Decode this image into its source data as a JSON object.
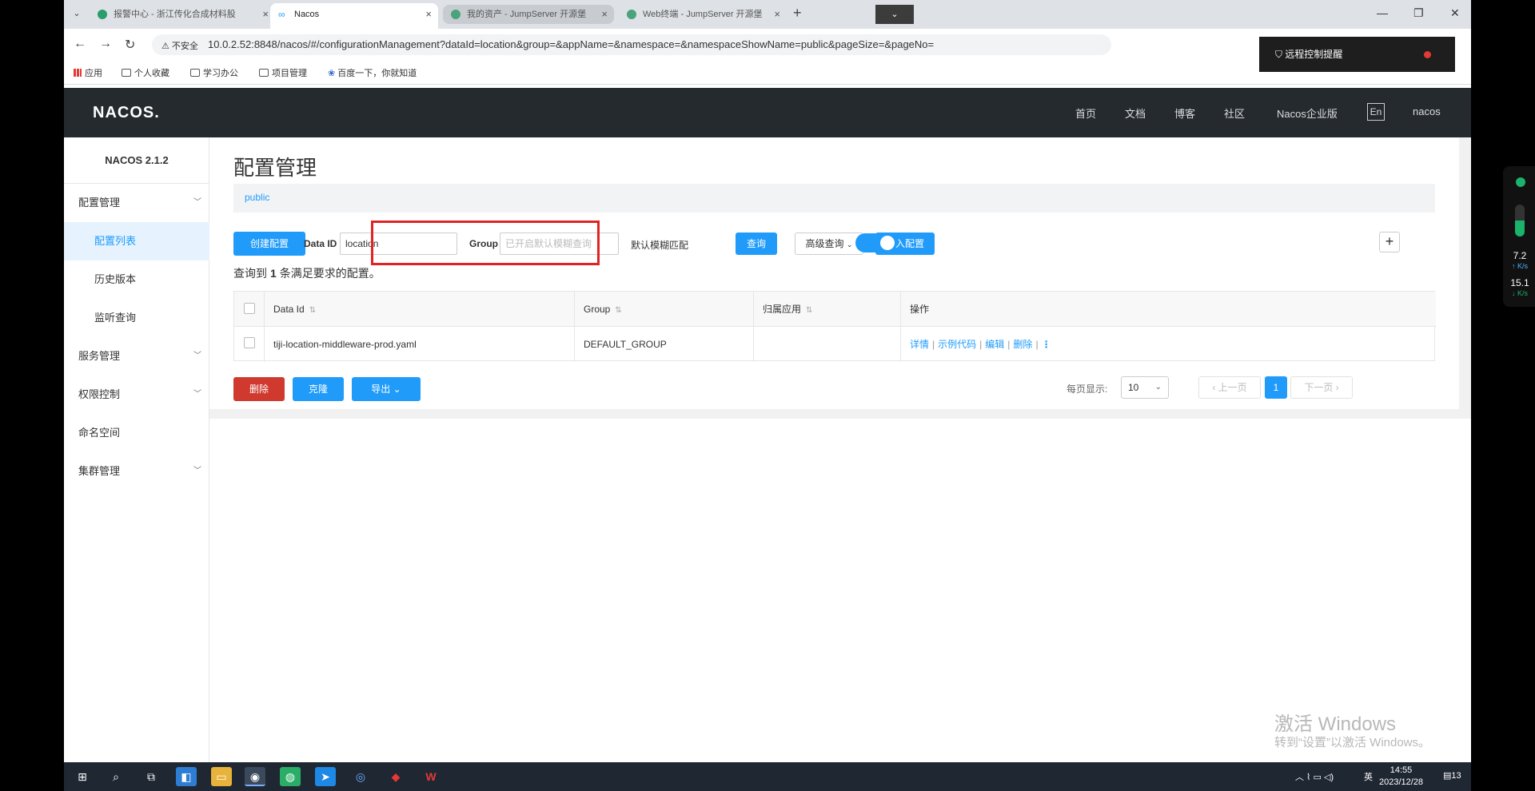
{
  "browser": {
    "tabs": [
      {
        "title": "报警中心 - 浙江传化合成材料股"
      },
      {
        "title": "Nacos"
      },
      {
        "title": "我的资产 - JumpServer 开源堡"
      },
      {
        "title": "Web终端 - JumpServer 开源堡"
      }
    ],
    "new_tab": "+",
    "security_label": "不安全",
    "url": "10.0.2.52:8848/nacos/#/configurationManagement?dataId=location&group=&appName=&namespace=&namespaceShowName=public&pageSize=&pageNo=",
    "bookmarks": [
      "应用",
      "个人收藏",
      "学习办公",
      "项目管理",
      "百度一下，你就知道"
    ],
    "remote_alert": "远程控制提醒"
  },
  "header": {
    "logo": "NACOS.",
    "links": [
      "首页",
      "文档",
      "博客",
      "社区",
      "Nacos企业版"
    ],
    "lang": "En",
    "user": "nacos"
  },
  "sidebar": {
    "version": "NACOS 2.1.2",
    "items": [
      {
        "label": "配置管理"
      },
      {
        "label": "配置列表"
      },
      {
        "label": "历史版本"
      },
      {
        "label": "监听查询"
      },
      {
        "label": "服务管理"
      },
      {
        "label": "权限控制"
      },
      {
        "label": "命名空间"
      },
      {
        "label": "集群管理"
      }
    ]
  },
  "main": {
    "title": "配置管理",
    "namespace": "public",
    "toolbar": {
      "create": "创建配置",
      "dataid_label": "Data ID",
      "dataid_value": "location",
      "group_label": "Group",
      "group_placeholder": "已开启默认模糊查询",
      "fuzzy_label": "默认模糊匹配",
      "fuzzy_on": true,
      "query": "查询",
      "advanced": "高级查询",
      "import": "导入配置",
      "add": "+"
    },
    "result": {
      "prefix": "查询到",
      "count": "1",
      "suffix": "条满足要求的配置。"
    },
    "table": {
      "headers": [
        "Data Id",
        "Group",
        "归属应用",
        "操作"
      ],
      "rows": [
        {
          "data_id": "tiji-location-middleware-prod.yaml",
          "group": "DEFAULT_GROUP",
          "app": "",
          "ops": [
            "详情",
            "示例代码",
            "编辑",
            "删除"
          ]
        }
      ]
    },
    "bottom": {
      "delete": "删除",
      "clone": "克隆",
      "export": "导出"
    },
    "pager": {
      "label": "每页显示:",
      "page_size": "10",
      "prev": "上一页",
      "current": "1",
      "next": "下一页"
    }
  },
  "watermark": {
    "line1": "激活 Windows",
    "line2": "转到“设置”以激活 Windows。"
  },
  "taskbar": {
    "ime": "英",
    "time": "14:55",
    "date": "2023/12/28",
    "notifications": "13"
  },
  "widget": {
    "up": "7.2",
    "down": "15.1",
    "unit": "K/s"
  },
  "colors": {
    "accent": "#209bfa",
    "danger": "#d0392e",
    "header_bg": "#252a2f",
    "highlight": "#e02424"
  }
}
